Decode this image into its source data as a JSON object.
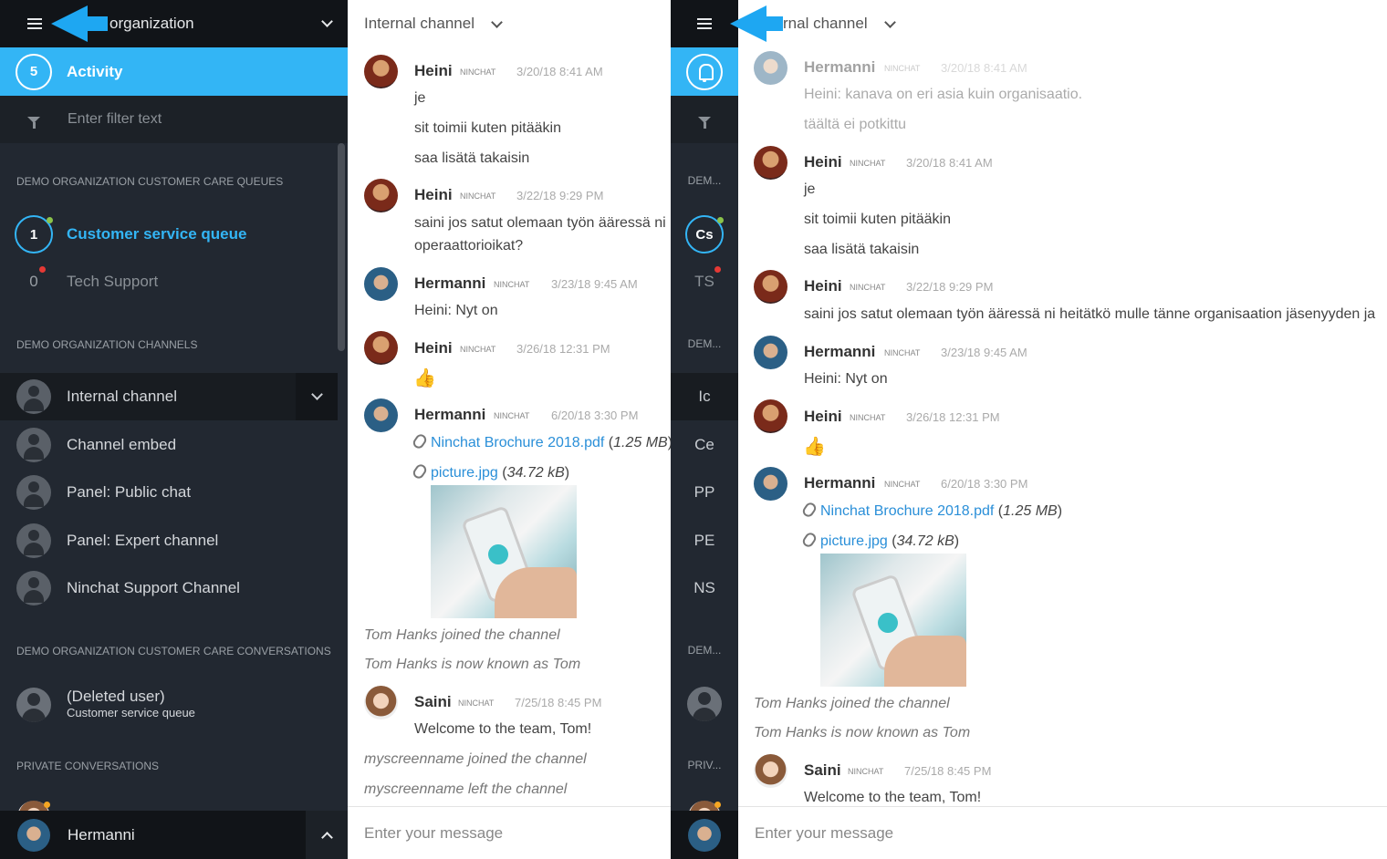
{
  "sidebar": {
    "org_name": "organization",
    "activity": {
      "count": "5",
      "label": "Activity"
    },
    "filter_placeholder": "Enter filter text",
    "sections": {
      "queues": "DEMO ORGANIZATION CUSTOMER CARE QUEUES",
      "channels": "DEMO ORGANIZATION CHANNELS",
      "conversations": "DEMO ORGANIZATION CUSTOMER CARE CONVERSATIONS",
      "private": "PRIVATE CONVERSATIONS"
    },
    "queues": [
      {
        "count": "1",
        "label": "Customer service queue",
        "status_color": "#8bc34a"
      },
      {
        "count": "0",
        "label": "Tech Support",
        "status_color": "#e53935"
      }
    ],
    "channels": [
      {
        "label": "Internal channel"
      },
      {
        "label": "Channel embed"
      },
      {
        "label": "Panel: Public chat"
      },
      {
        "label": "Panel: Expert channel"
      },
      {
        "label": "Ninchat Support Channel"
      }
    ],
    "conversation": {
      "name": "(Deleted user)",
      "queue": "Customer service queue"
    },
    "current_user": "Hermanni"
  },
  "mini_sidebar": {
    "queue_abbr": "Cs",
    "queue2_abbr": "TS",
    "section_abbr": "DEM...",
    "private_abbr": "PRIV...",
    "channels": [
      "Ic",
      "Ce",
      "PP",
      "PE",
      "NS"
    ]
  },
  "chat1": {
    "title": "Internal channel",
    "compose_placeholder": "Enter your message",
    "m1": {
      "name": "Heini",
      "tag": "NINCHAT",
      "time": "3/20/18 8:41 AM",
      "lines": [
        "je",
        "sit toimii kuten pitääkin",
        "saa lisätä takaisin"
      ]
    },
    "m2": {
      "name": "Heini",
      "tag": "NINCHAT",
      "time": "3/22/18 9:29 PM",
      "lines": [
        "saini jos satut olemaan työn ääressä ni",
        "operaattorioikat?"
      ]
    },
    "m3": {
      "name": "Hermanni",
      "tag": "NINCHAT",
      "time": "3/23/18 9:45 AM",
      "lines": [
        "Heini: Nyt on"
      ]
    },
    "m4": {
      "name": "Heini",
      "tag": "NINCHAT",
      "time": "3/26/18 12:31 PM",
      "emoji": "👍"
    },
    "m5": {
      "name": "Hermanni",
      "tag": "NINCHAT",
      "time": "6/20/18 3:30 PM",
      "file1": "Ninchat Brochure 2018.pdf",
      "file1_size": "1.25 MB",
      "file2": "picture.jpg",
      "file2_size": "34.72 kB"
    },
    "sys1": "Tom Hanks joined the channel",
    "sys2": "Tom Hanks is now known as Tom",
    "m6": {
      "name": "Saini",
      "tag": "NINCHAT",
      "time": "7/25/18 8:45 PM",
      "lines": [
        "Welcome to the team, Tom!"
      ]
    },
    "sys3": "myscreenname joined the channel",
    "sys4": "myscreenname left the channel"
  },
  "chat2": {
    "title": "rnal channel",
    "compose_placeholder": "Enter your message",
    "m0": {
      "name": "Hermanni",
      "tag": "NINCHAT",
      "time": "3/20/18 8:41 AM",
      "lines": [
        "Heini: kanava on eri asia kuin organisaatio.",
        "täältä ei potkittu"
      ]
    },
    "m1": {
      "name": "Heini",
      "tag": "NINCHAT",
      "time": "3/20/18 8:41 AM",
      "lines": [
        "je",
        "sit toimii kuten pitääkin",
        "saa lisätä takaisin"
      ]
    },
    "m2": {
      "name": "Heini",
      "tag": "NINCHAT",
      "time": "3/22/18 9:29 PM",
      "lines": [
        "saini jos satut olemaan työn ääressä ni heitätkö mulle tänne organisaation jäsenyyden ja"
      ]
    },
    "m3": {
      "name": "Hermanni",
      "tag": "NINCHAT",
      "time": "3/23/18 9:45 AM",
      "lines": [
        "Heini: Nyt on"
      ]
    },
    "m4": {
      "name": "Heini",
      "tag": "NINCHAT",
      "time": "3/26/18 12:31 PM",
      "emoji": "👍"
    },
    "m5": {
      "name": "Hermanni",
      "tag": "NINCHAT",
      "time": "6/20/18 3:30 PM",
      "file1": "Ninchat Brochure 2018.pdf",
      "file1_size": "1.25 MB",
      "file2": "picture.jpg",
      "file2_size": "34.72 kB"
    },
    "sys1": "Tom Hanks joined the channel",
    "sys2": "Tom Hanks is now known as Tom",
    "m6": {
      "name": "Saini",
      "tag": "NINCHAT",
      "time": "7/25/18 8:45 PM",
      "lines": [
        "Welcome to the team, Tom!"
      ]
    }
  },
  "colors": {
    "accent": "#33b5f5",
    "sidebar_bg": "#222831",
    "arrow": "#1ea7f2",
    "link": "#2a8fd8"
  }
}
